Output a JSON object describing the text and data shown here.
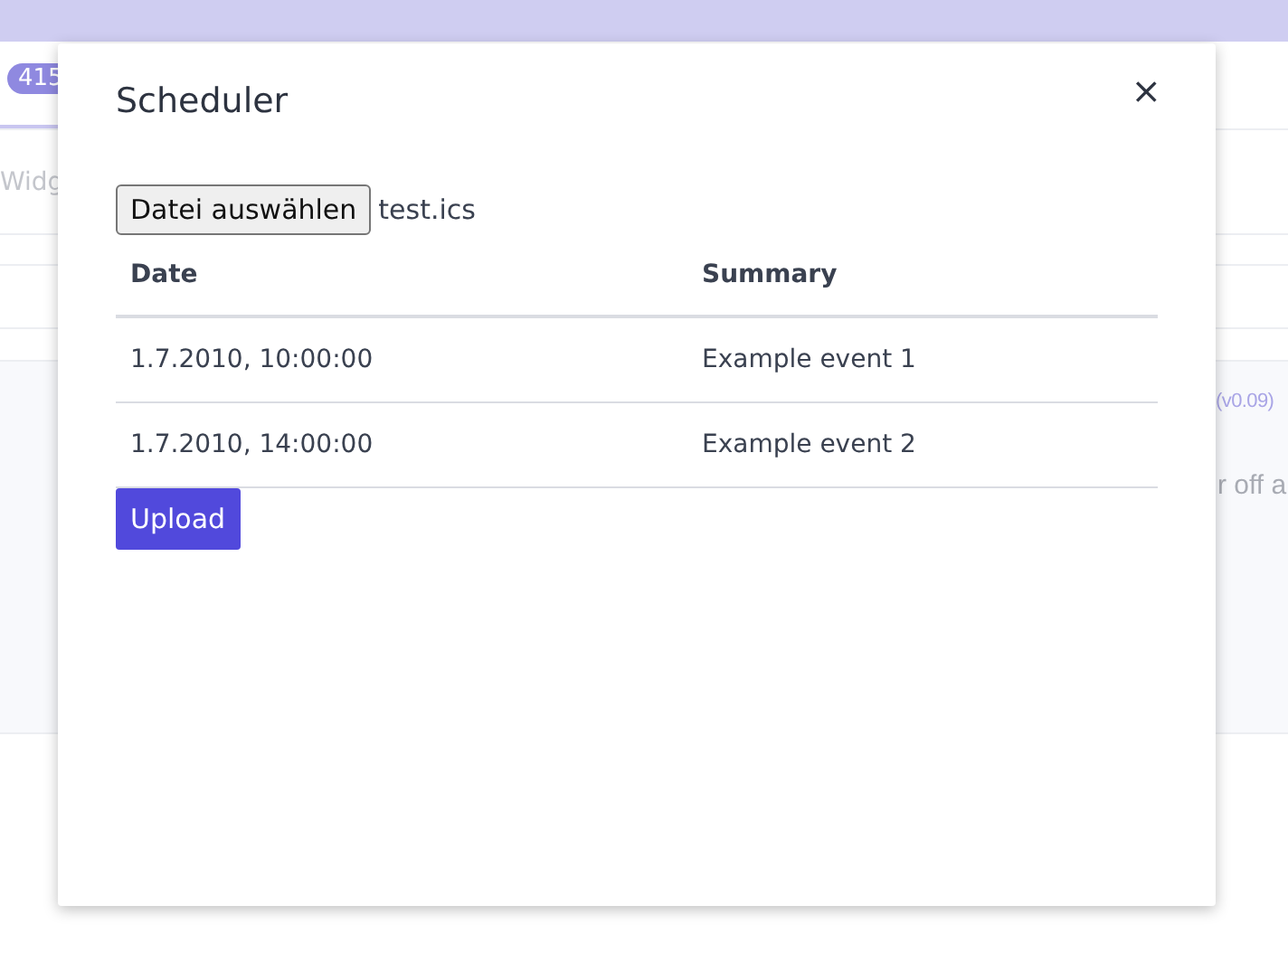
{
  "background": {
    "badge": "415",
    "tab_fragment": "Widg",
    "version_fragment": "(v0.09)",
    "text_fragment": "r off a"
  },
  "dialog": {
    "title": "Scheduler",
    "close": "×",
    "file_input": {
      "button": "Datei auswählen",
      "value": "test.ics"
    },
    "table": {
      "columns": [
        "Date",
        "Summary"
      ],
      "rows": [
        [
          "1.7.2010, 10:00:00",
          "Example event 1"
        ],
        [
          "1.7.2010, 14:00:00",
          "Example event 2"
        ]
      ]
    },
    "upload": "Upload"
  }
}
